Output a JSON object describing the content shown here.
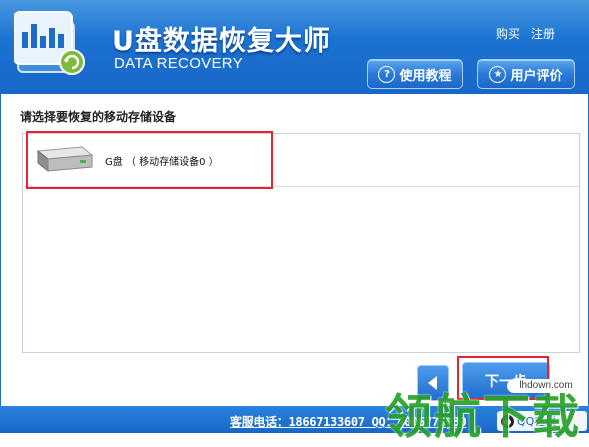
{
  "header": {
    "title": "U盘数据恢复大师",
    "subtitle": "DATA RECOVERY",
    "links": [
      "购买",
      "注册"
    ],
    "help_button": "使用教程",
    "review_button": "用户评价"
  },
  "main": {
    "section_label": "请选择要恢复的移动存储设备",
    "devices": [
      {
        "label": "G盘 （ 移动存储设备0 ）",
        "icon": "usb-drive-icon"
      }
    ],
    "back_button_icon": "back-arrow-icon",
    "next_button": "下一步"
  },
  "footer": {
    "contact": "客服电话：18667133607 QQ：4006779030",
    "qq_label": "QQ在线"
  },
  "watermark": {
    "site": "lhdown.com",
    "text": "领航下载"
  },
  "colors": {
    "header_blue": "#1a6fcf",
    "highlight_red": "#e0262e",
    "watermark_green": "#27a12a"
  }
}
